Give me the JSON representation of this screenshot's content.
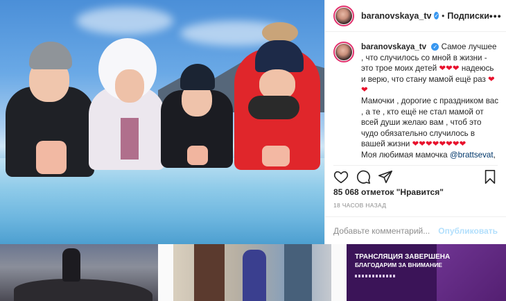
{
  "post": {
    "username": "baranovskaya_tv",
    "follow_label": "Подписки",
    "more_label": "•••",
    "caption_parts": [
      "Самое лучшее , что случилось со мной в жизни - это трое моих детей",
      "надеюсь и верю, что стану мамой ещё раз",
      "Мамочки , дорогие с праздником вас , а те , кто ещё не стал мамой от всей души желаю вам , чтоб это чудо обязательно случилось в вашей жизни",
      "Моя любимая мамочка",
      "@brattsevat",
      ","
    ],
    "likes": "85 068 отметок \"Нравится\"",
    "time": "18 ЧАСОВ НАЗАД",
    "comment_placeholder": "Добавьте комментарий...",
    "publish_label": "Опубликовать"
  },
  "grid": {
    "stream_title": "ТРАНСЛЯЦИЯ ЗАВЕРШЕНА",
    "stream_sub": "БЛАГОДАРИМ ЗА ВНИМАНИЕ"
  },
  "icons": [
    "heart-icon",
    "comment-icon",
    "share-icon",
    "bookmark-icon",
    "verified-icon",
    "more-icon"
  ],
  "colors": {
    "accent": "#3897f0",
    "heart": "#e8112d",
    "publish": "#b2dffc"
  }
}
